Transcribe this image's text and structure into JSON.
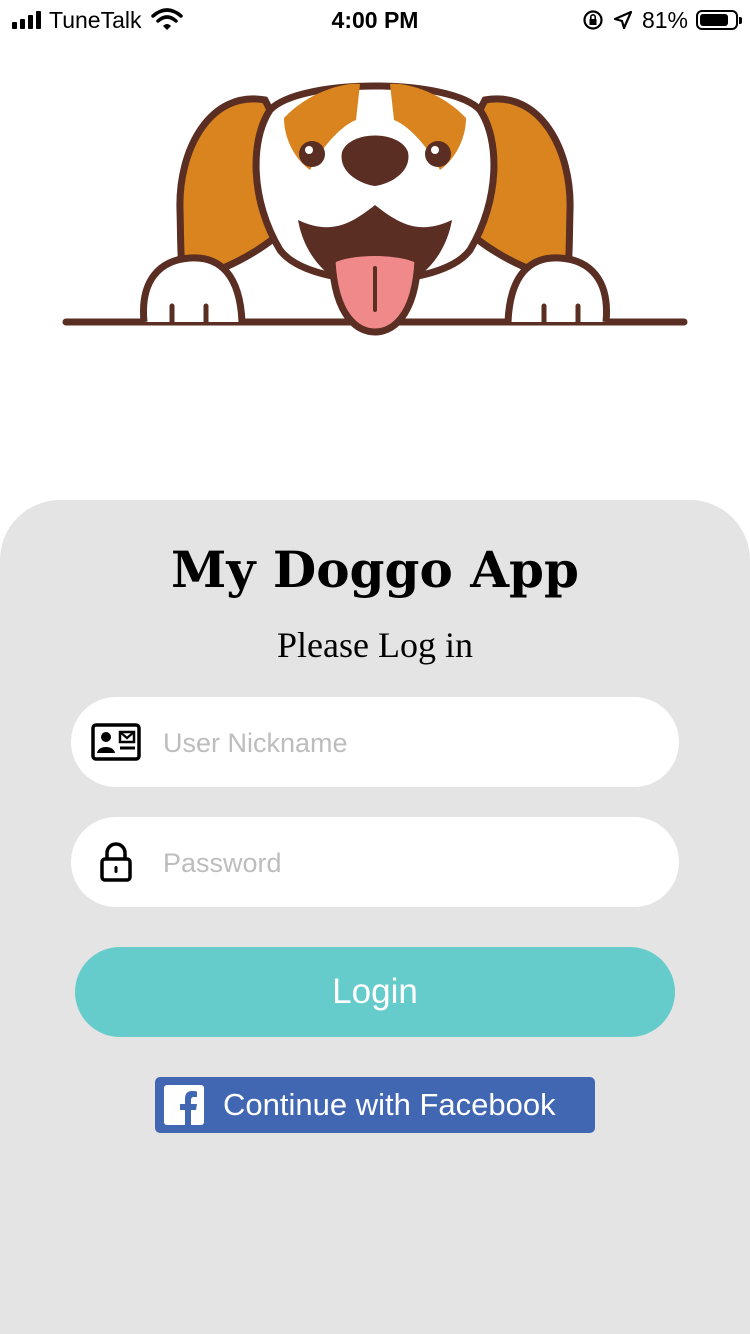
{
  "status_bar": {
    "carrier": "TuneTalk",
    "time": "4:00 PM",
    "battery_percent_label": "81%",
    "battery_level": 0.81,
    "icons": [
      "signal-bars-icon",
      "wifi-icon",
      "orientation-lock-icon",
      "location-arrow-icon",
      "battery-icon"
    ]
  },
  "hero": {
    "image": "beagle-dog-illustration",
    "colors": {
      "ear": "#d9841e",
      "outline": "#5a2e22",
      "tongue": "#f08a8a"
    }
  },
  "login": {
    "title": "My Doggo App",
    "subtitle": "Please Log in",
    "nickname_placeholder": "User Nickname",
    "nickname_value": "",
    "password_placeholder": "Password",
    "password_value": "",
    "login_label": "Login",
    "facebook_label": "Continue with Facebook",
    "icons": {
      "nickname": "id-card-icon",
      "password": "padlock-icon",
      "facebook": "facebook-logo-icon"
    }
  },
  "colors": {
    "panel_bg": "#e4e4e4",
    "login_button": "#66cccb",
    "facebook_button": "#4267b2"
  }
}
